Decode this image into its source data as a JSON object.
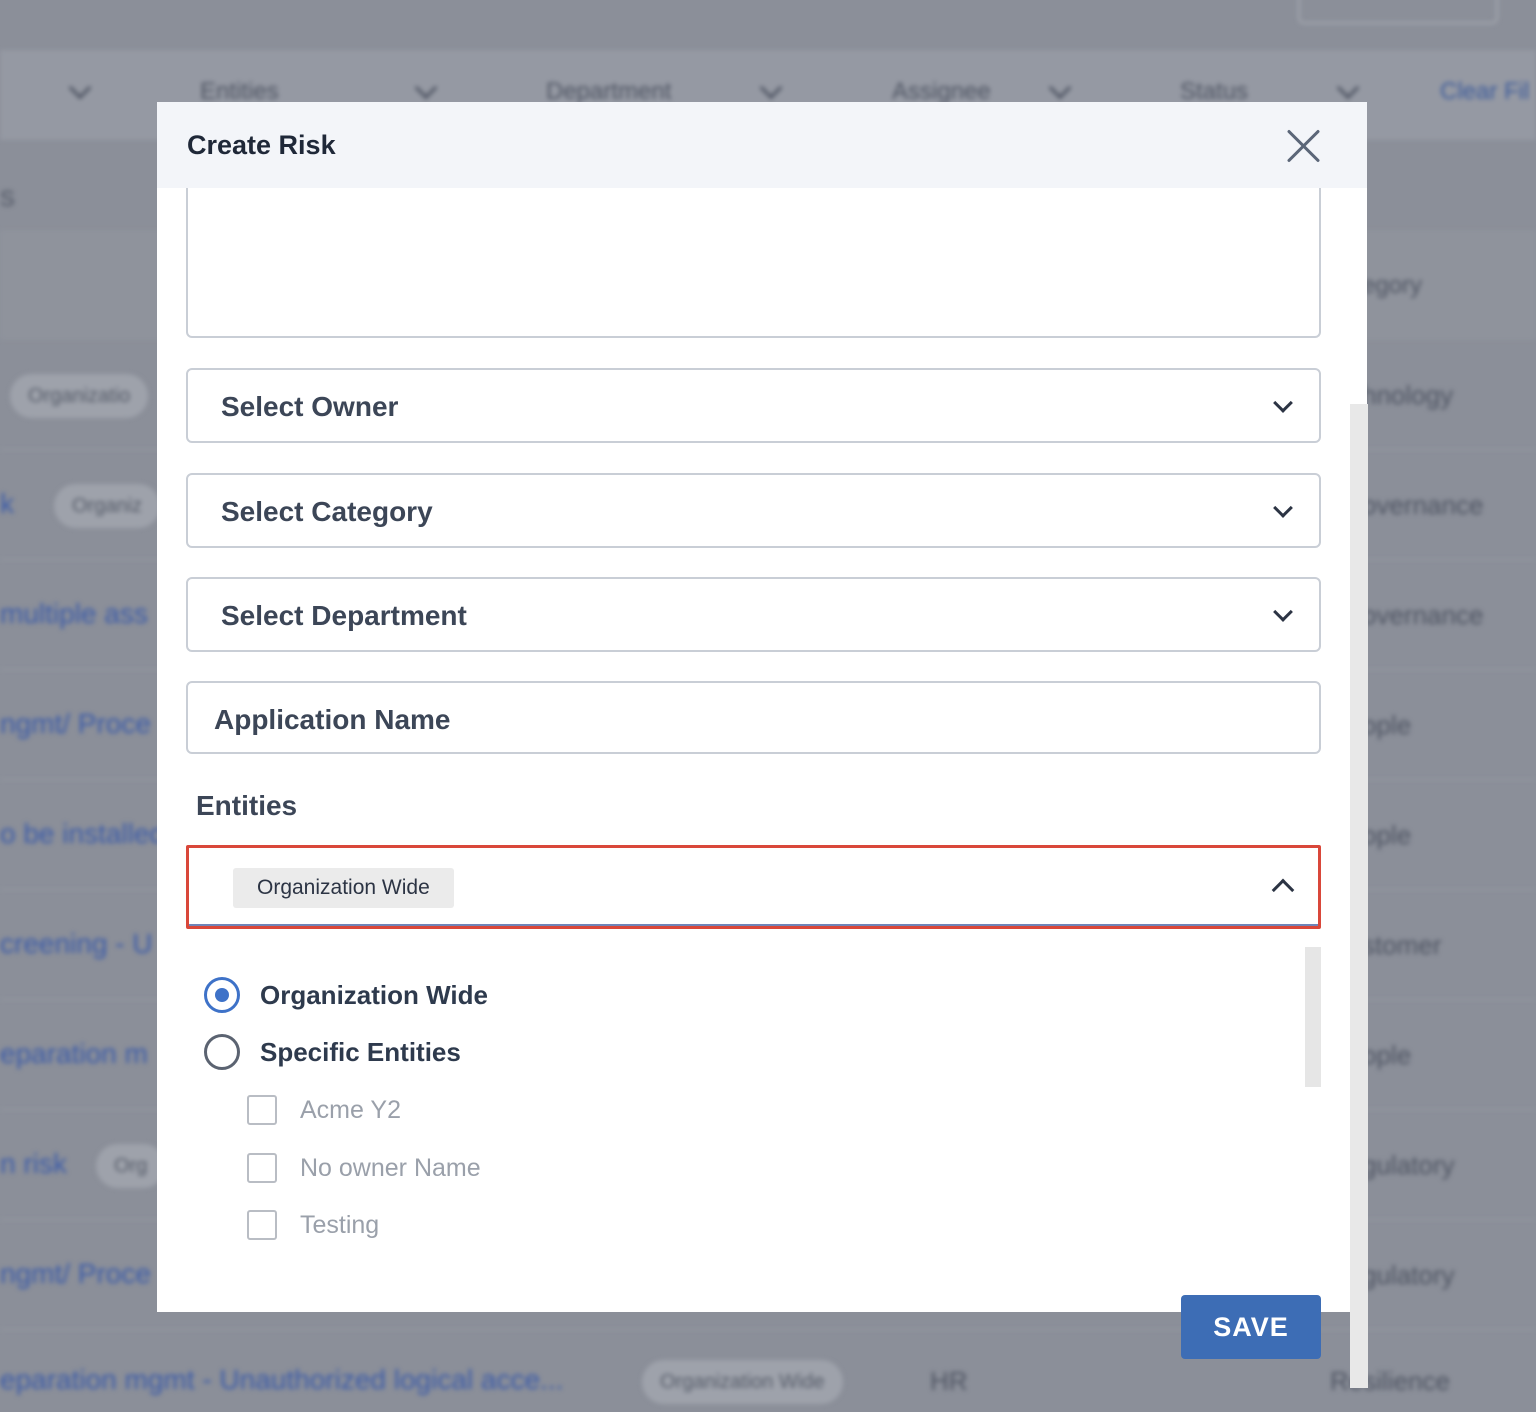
{
  "background": {
    "filters": [
      "Entities",
      "Department",
      "Assignee",
      "Status"
    ],
    "clear_filters": "Clear Fil",
    "list_stub": "S",
    "category_header": "egory",
    "rows": [
      {
        "title": "",
        "pill": "Organizatio",
        "category": "hnology"
      },
      {
        "title": "k",
        "pill": "Organiz",
        "category": "overnance"
      },
      {
        "title": "multiple ass",
        "pill": "",
        "category": "overnance"
      },
      {
        "title": "ngmt/ Proce",
        "pill": "",
        "category": "ople"
      },
      {
        "title": "o be installed",
        "pill": "",
        "category": "ople"
      },
      {
        "title": "creening - U",
        "pill": "",
        "category": "stomer"
      },
      {
        "title": "eparation m",
        "pill": "",
        "category": "ople"
      },
      {
        "title": "n risk",
        "pill": "Org",
        "category": "gulatory"
      },
      {
        "title": "ngmt/ Proce",
        "pill": "",
        "category": "gulatory"
      },
      {
        "title": "eparation mgmt - Unauthorized logical acce...",
        "pill": "Organization Wide",
        "department": "HR",
        "category": "Resilience"
      }
    ]
  },
  "modal": {
    "title": "Create Risk",
    "owner_placeholder": "Select Owner",
    "category_placeholder": "Select Category",
    "department_placeholder": "Select Department",
    "application_name": "Application Name",
    "entities_label": "Entities",
    "entities_selected_chip": "Organization Wide",
    "radio_options": [
      {
        "label": "Organization Wide",
        "checked": true
      },
      {
        "label": "Specific Entities",
        "checked": false
      }
    ],
    "entity_checkboxes": [
      {
        "label": "Acme Y2",
        "checked": false
      },
      {
        "label": "No owner Name",
        "checked": false
      },
      {
        "label": "Testing",
        "checked": false
      }
    ],
    "save_label": "SAVE"
  },
  "colors": {
    "primary_button": "#3d6db5",
    "focus_border": "#d9473a",
    "radio_checked": "#3e72c8",
    "overlay": "#8b8f99"
  },
  "icons": {
    "close": "close-icon",
    "dropdown": "chevron-down-icon",
    "collapse": "chevron-up-icon"
  }
}
